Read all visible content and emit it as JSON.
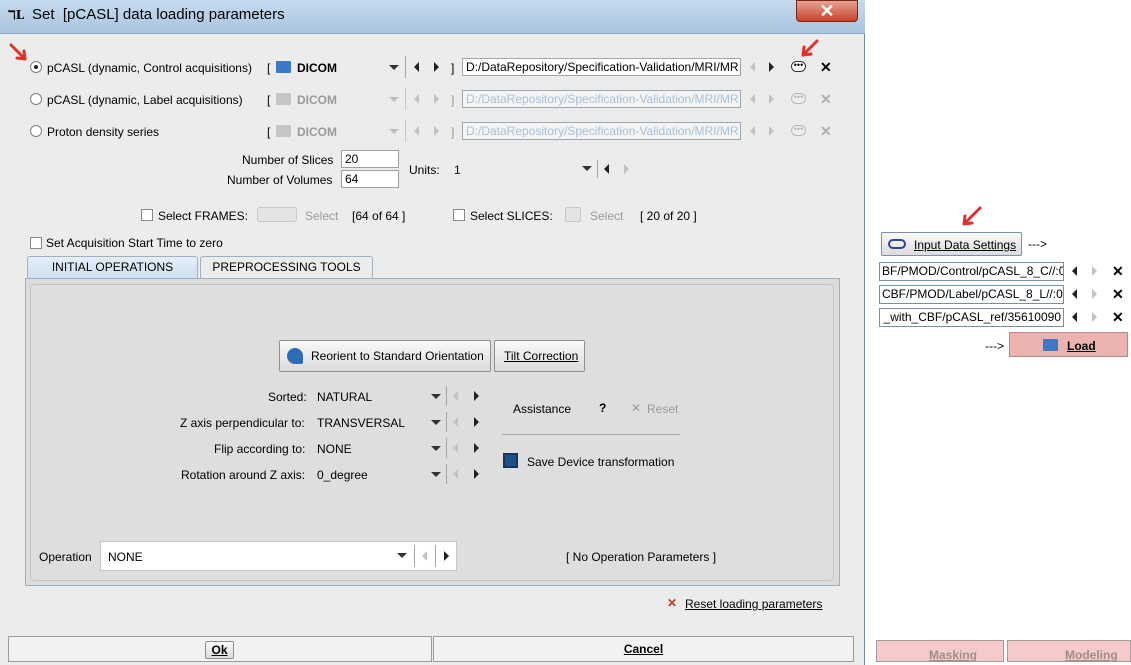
{
  "window": {
    "title": "Set  [pCASL] data loading parameters",
    "app_icon": "ℸL",
    "close_label": "✕"
  },
  "series": [
    {
      "label": "pCASL (dynamic, Control acquisitions)",
      "format": "DICOM",
      "path": "D:/DataRepository/Specification-Validation/MRI/MR",
      "selected": true
    },
    {
      "label": "pCASL (dynamic, Label acquisitions)",
      "format": "DICOM",
      "path": "D:/DataRepository/Specification-Validation/MRI/MR",
      "selected": false
    },
    {
      "label": "Proton density series",
      "format": "DICOM",
      "path": "D:/DataRepository/Specification-Validation/MRI/MR",
      "selected": false
    }
  ],
  "bracket": "[",
  "bracket_close": "]",
  "slices": {
    "label": "Number of Slices",
    "value": "20"
  },
  "volumes": {
    "label": "Number of Volumes",
    "value": "64"
  },
  "units": {
    "label": "Units:",
    "value": "1"
  },
  "frames": {
    "label": "Select FRAMES:",
    "select": "Select",
    "count": "[64 of 64 ]"
  },
  "slice_sel": {
    "label": "Select SLICES:",
    "select": "Select",
    "count": "[ 20 of 20 ]"
  },
  "acq_start": {
    "label": "Set Acquisition Start Time to zero"
  },
  "tabs": [
    {
      "label": "INITIAL OPERATIONS"
    },
    {
      "label": "PREPROCESSING TOOLS"
    }
  ],
  "reorient_label": "Reorient to Standard Orientation",
  "tilt_label": "Tilt Correction",
  "settings": [
    {
      "label": "Sorted:",
      "value": "NATURAL"
    },
    {
      "label": "Z axis perpendicular to:",
      "value": "TRANSVERSAL"
    },
    {
      "label": "Flip according to:",
      "value": "NONE"
    },
    {
      "label": "Rotation around Z axis:",
      "value": "0_degree"
    }
  ],
  "assistance": {
    "label": "Assistance",
    "help": "?",
    "reset": "Reset"
  },
  "save_device": "Save Device transformation",
  "operation": {
    "label": "Operation",
    "value": "NONE",
    "params": "[ No Operation Parameters ]"
  },
  "reset_loading": "Reset loading parameters",
  "ok_label": "Ok",
  "cancel_label": "Cancel",
  "right": {
    "input_settings": "Input Data Settings",
    "arrow1": "--->",
    "fields": [
      "BF/PMOD/Control/pCASL_8_C//:0",
      "CBF/PMOD/Label/pCASL_8_L//:0",
      "_with_CBF/pCASL_ref/35610090"
    ],
    "arrow2": "--->",
    "load": "Load",
    "masking": "Masking",
    "modeling": "Modeling"
  }
}
